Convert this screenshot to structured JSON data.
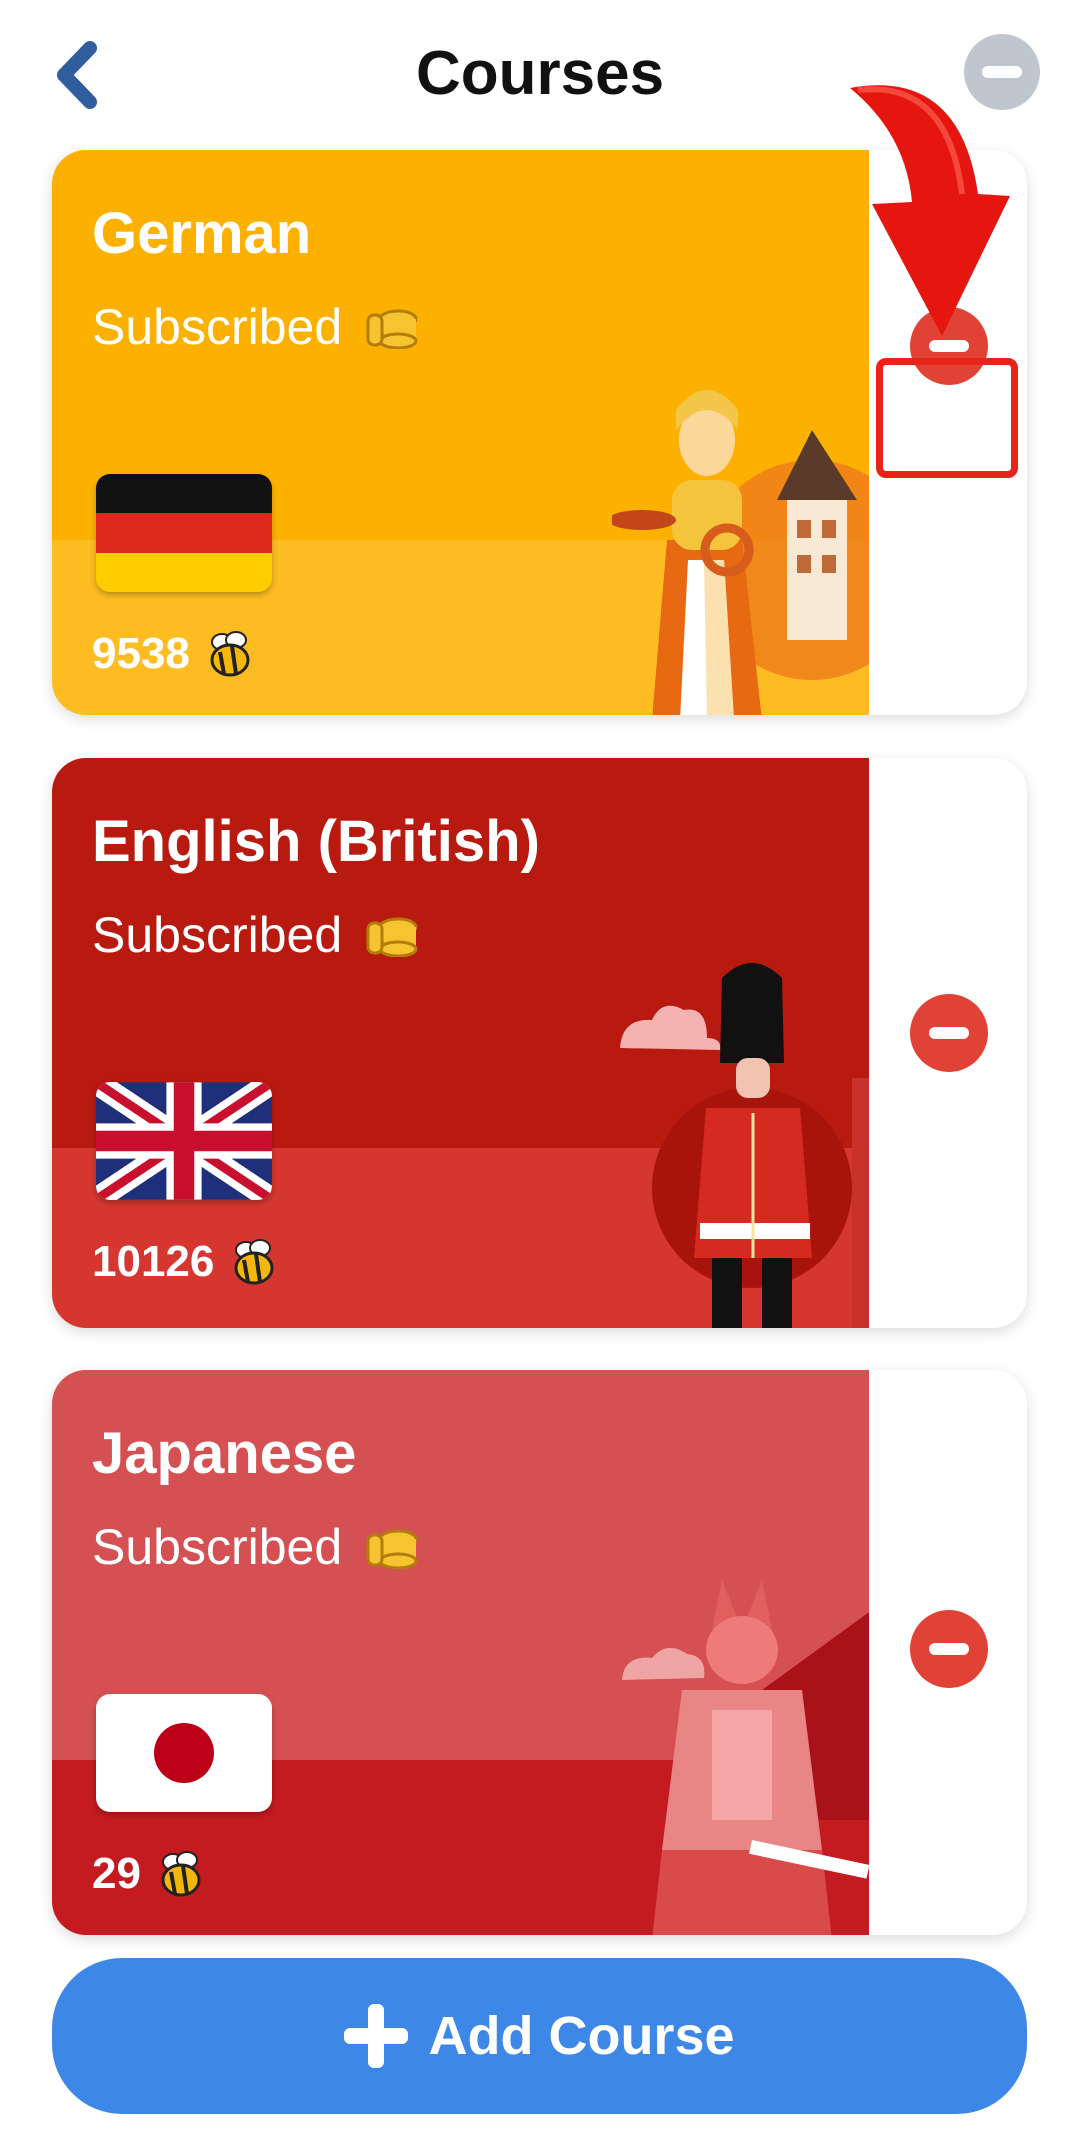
{
  "header": {
    "title": "Courses",
    "back_icon": "chevron-left-icon",
    "edit_icon": "minus-circle-icon"
  },
  "courses": [
    {
      "name": "German",
      "status": "Subscribed",
      "status_icon": "coins-icon",
      "count": "9538",
      "count_icon": "bee-icon",
      "flag": "germany-flag",
      "colors": {
        "top": "#fcb100",
        "bottom": "#fdbc22"
      }
    },
    {
      "name": "English (British)",
      "status": "Subscribed",
      "status_icon": "coins-icon",
      "count": "10126",
      "count_icon": "bee-icon",
      "flag": "uk-flag",
      "colors": {
        "top": "#b81a10",
        "bottom": "#d53730"
      }
    },
    {
      "name": "Japanese",
      "status": "Subscribed",
      "status_icon": "coins-icon",
      "count": "29",
      "count_icon": "bee-icon",
      "flag": "japan-flag",
      "colors": {
        "top": "#d55052",
        "bottom": "#c31b20"
      }
    }
  ],
  "remove_icon": "minus-circle-icon",
  "add_button": {
    "label": "Add Course",
    "icon": "plus-icon"
  },
  "accent": {
    "remove": "#e04235",
    "add": "#3d87e6",
    "highlight": "#e8231a"
  }
}
